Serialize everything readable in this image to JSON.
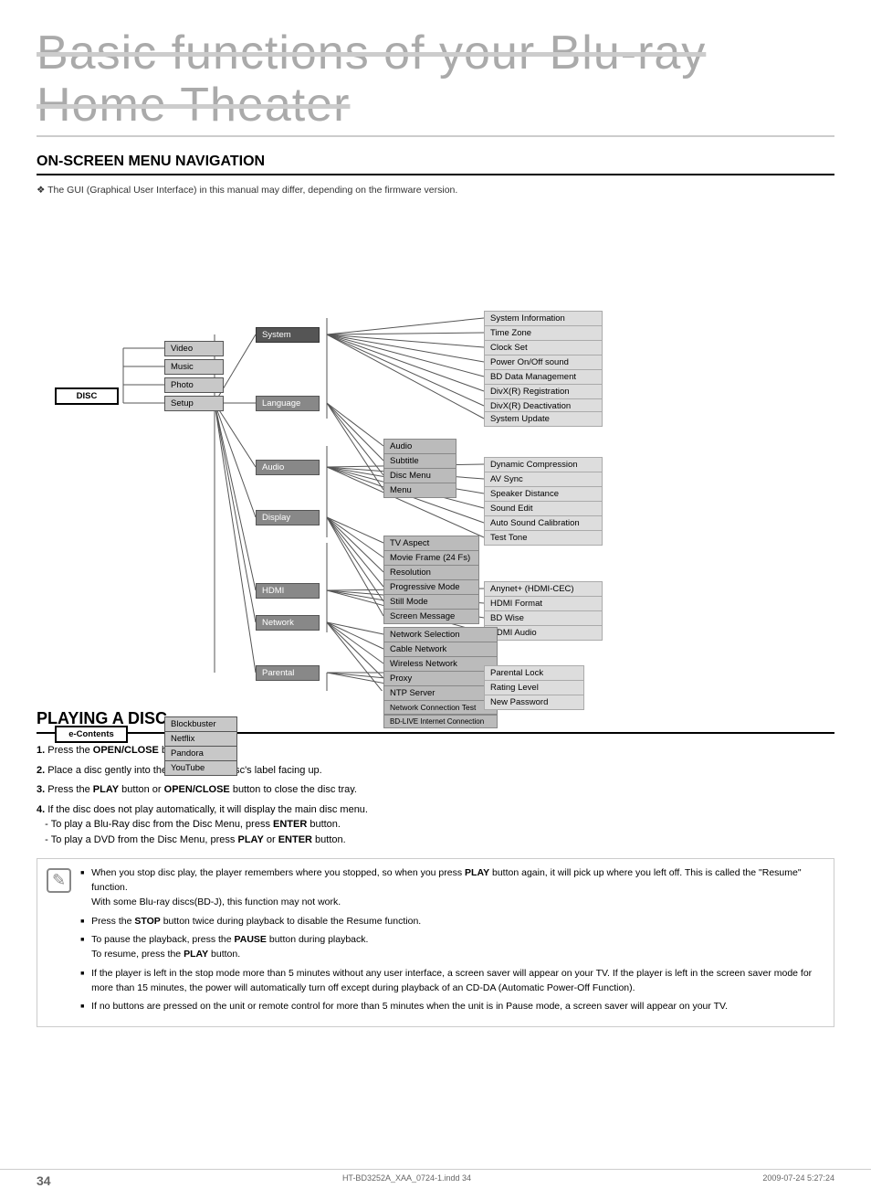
{
  "page": {
    "title": "Basic functions of your Blu-ray Home Theater",
    "page_number": "34",
    "footer_left": "HT-BD3252A_XAA_0724-1.indd  34",
    "footer_right": "2009-07-24   5:27:24"
  },
  "section1": {
    "title": "ON-SCREEN MENU NAVIGATION",
    "note": "The GUI (Graphical User Interface) in this manual may differ, depending on the firmware version."
  },
  "section2": {
    "title": "PLAYING A DISC",
    "steps": [
      {
        "num": "1.",
        "text_before": "Press the ",
        "bold": "OPEN/CLOSE",
        "text_after": " button."
      },
      {
        "num": "2.",
        "text_before": "Place a disc gently into the tray with the disc's label facing up.",
        "bold": "",
        "text_after": ""
      },
      {
        "num": "3.",
        "text_before": "Press the ",
        "bold": "PLAY",
        "text_after": " button or ",
        "bold2": "OPEN/CLOSE",
        "text_after2": " button to close the disc tray."
      },
      {
        "num": "4.",
        "text_before": "If the disc does not play automatically, it will display the main disc menu.",
        "bold": "",
        "text_after": ""
      }
    ],
    "substeps": [
      "- To play a Blu-Ray disc from the Disc Menu, press ENTER button.",
      "- To play a DVD from the Disc Menu, press PLAY or ENTER button."
    ],
    "notes": [
      "When you stop disc play, the player remembers where you stopped, so when you press PLAY button again, it will pick up where you left off. This is called the \"Resume\" function.\nWith some Blu-ray discs(BD-J), this function may not work.",
      "Press the STOP button twice during playback to disable the Resume function.",
      "To pause the playback, press the PAUSE button during playback.\nTo resume, press the PLAY button.",
      "If the player is left in the stop mode more than 5 minutes without any user interface, a screen saver will appear on your TV. If the player is left in the screen saver mode for more than 15 minutes, the power will automatically turn off except during playback of an CD-DA (Automatic Power-Off Function).",
      "If no buttons are pressed on the unit or remote control for more than 5 minutes when the unit is in Pause mode, a screen saver will appear on your TV."
    ]
  },
  "tree": {
    "disc": "DISC",
    "video": "Video",
    "music": "Music",
    "photo": "Photo",
    "setup": "Setup",
    "system": "System",
    "language": "Language",
    "audio_lang": "Audio",
    "subtitle": "Subtitle",
    "disc_menu": "Disc Menu",
    "menu": "Menu",
    "audio_setup": "Audio",
    "display": "Display",
    "tv_aspect": "TV Aspect",
    "movie_frame": "Movie Frame (24 Fs)",
    "resolution": "Resolution",
    "progressive": "Progressive Mode",
    "still_mode": "Still Mode",
    "screen_msg": "Screen Message",
    "hdmi": "HDMI",
    "network": "Network",
    "net_selection": "Network Selection",
    "cable": "Cable Network",
    "wireless": "Wireless Network",
    "proxy": "Proxy",
    "ntp": "NTP Server",
    "net_test": "Network Connection Test",
    "bdlive": "BD-LIVE Internet Connection",
    "parental": "Parental",
    "sys_info": "System Information",
    "time_zone": "Time Zone",
    "clock_set": "Clock Set",
    "power_sound": "Power On/Off sound",
    "bd_data": "BD Data Management",
    "divx_reg": "DivX(R) Registration",
    "divx_deact": "DivX(R) Deactivation",
    "sys_update": "System Update",
    "dynamic": "Dynamic Compression",
    "av_sync": "AV Sync",
    "speaker_dist": "Speaker Distance",
    "sound_edit": "Sound Edit",
    "auto_sound": "Auto Sound Calibration",
    "test_tone": "Test Tone",
    "anynet": "Anynet+ (HDMI-CEC)",
    "hdmi_format": "HDMI Format",
    "bd_wise": "BD Wise",
    "hdmi_audio": "HDMI Audio",
    "parental_lock": "Parental Lock",
    "rating": "Rating Level",
    "new_pass": "New Password",
    "econtents": "e-Contents",
    "blockbuster": "Blockbuster",
    "netflix": "Netflix",
    "pandora": "Pandora",
    "youtube": "YouTube"
  }
}
